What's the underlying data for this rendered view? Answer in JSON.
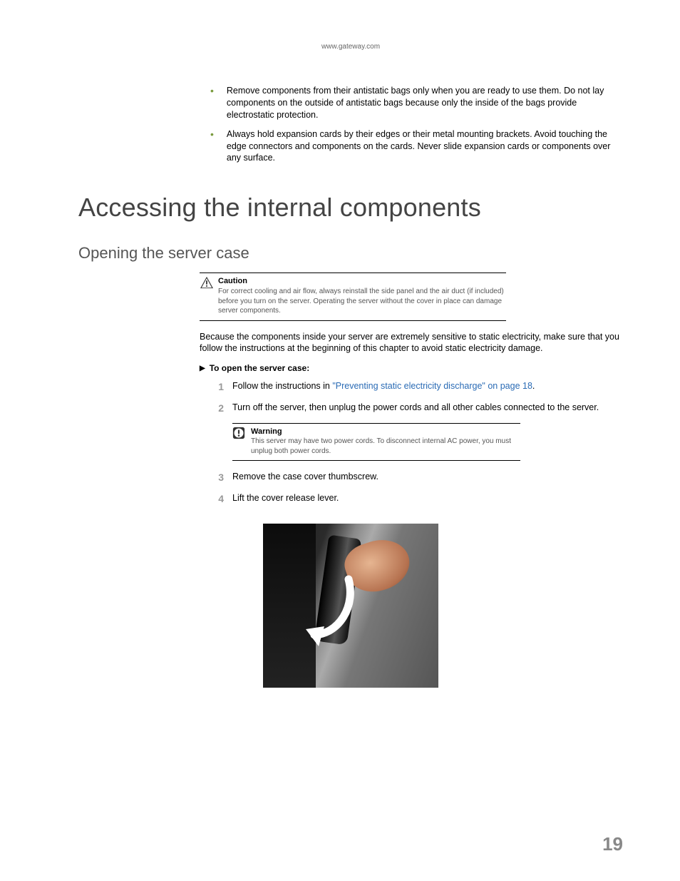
{
  "header": {
    "url": "www.gateway.com"
  },
  "bullets": [
    "Remove components from their antistatic bags only when you are ready to use them. Do not lay components on the outside of antistatic bags because only the inside of the bags provide electrostatic protection.",
    "Always hold expansion cards by their edges or their metal mounting brackets. Avoid touching the edge connectors and components on the cards. Never slide expansion cards or components over any surface."
  ],
  "h1": "Accessing the internal components",
  "h2": "Opening the server case",
  "caution": {
    "title": "Caution",
    "body": "For correct cooling and air flow, always reinstall the side panel and the air duct (if included) before you turn on the server. Operating the server without the cover in place can damage server components."
  },
  "intro_para": "Because the components inside your server are extremely sensitive to static electricity, make sure that you follow the instructions at the beginning of this chapter to avoid static electricity damage.",
  "proc_title": "To open the server case:",
  "steps": {
    "s1_pre": "Follow the instructions in ",
    "s1_link": "\"Preventing static electricity discharge\" on page 18",
    "s1_post": ".",
    "s2": "Turn off the server, then unplug the power cords and all other cables connected to the server.",
    "s3": "Remove the case cover thumbscrew.",
    "s4": "Lift the cover release lever."
  },
  "warning": {
    "title": "Warning",
    "body": "This server may have two power cords. To disconnect internal AC power, you must unplug both power cords."
  },
  "nums": {
    "n1": "1",
    "n2": "2",
    "n3": "3",
    "n4": "4"
  },
  "page_number": "19",
  "figure_alt": "Hand lifting the cover release lever on a server case"
}
